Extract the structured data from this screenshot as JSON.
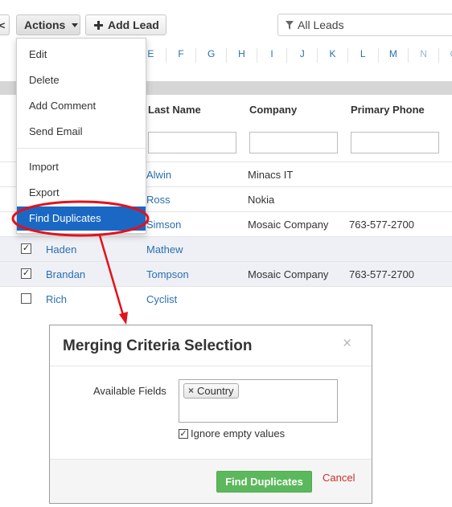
{
  "toolbar": {
    "back_glyph": "<",
    "actions_label": "Actions",
    "add_lead_label": "Add Lead",
    "filter_label": "All Leads"
  },
  "alphabet": [
    "E",
    "F",
    "G",
    "H",
    "I",
    "J",
    "K",
    "L",
    "M",
    "N",
    "O"
  ],
  "columns": {
    "last_name": "Last Name",
    "company": "Company",
    "primary_phone": "Primary Phone"
  },
  "rows": [
    {
      "first": "",
      "last": "Alwin",
      "company": "Minacs IT",
      "phone": "",
      "checked": ""
    },
    {
      "first": "",
      "last": "Ross",
      "company": "Nokia",
      "phone": "",
      "checked": ""
    },
    {
      "first": "",
      "last": "Simson",
      "company": "Mosaic Company",
      "phone": "763-577-2700",
      "checked": ""
    },
    {
      "first": "Haden",
      "last": "Mathew",
      "company": "",
      "phone": "",
      "checked": "✓"
    },
    {
      "first": "Brandan",
      "last": "Tompson",
      "company": "Mosaic Company",
      "phone": "763-577-2700",
      "checked": "✓"
    },
    {
      "first": "Rich",
      "last": "Cyclist",
      "company": "",
      "phone": "",
      "checked": ""
    }
  ],
  "actions_menu": {
    "items": [
      "Edit",
      "Delete",
      "Add Comment",
      "Send Email",
      "Import",
      "Export",
      "Find Duplicates"
    ],
    "active_item": "Find Duplicates"
  },
  "dialog": {
    "title": "Merging Criteria Selection",
    "close_glyph": "×",
    "available_fields_label": "Available Fields",
    "selected_field": "Country",
    "tag_remove_glyph": "×",
    "ignore_empty_label": "Ignore empty values",
    "ignore_empty_checked": "✓",
    "find_duplicates_label": "Find Duplicates",
    "cancel_label": "Cancel"
  },
  "colors": {
    "accent_red": "#e3111b",
    "menu_active": "#1a68c4",
    "success_green": "#5cb85c",
    "link_blue": "#2a6fb0"
  },
  "icons": {
    "back": "chevron-left-icon",
    "add": "plus-icon",
    "filter": "funnel-icon",
    "close": "close-icon"
  }
}
